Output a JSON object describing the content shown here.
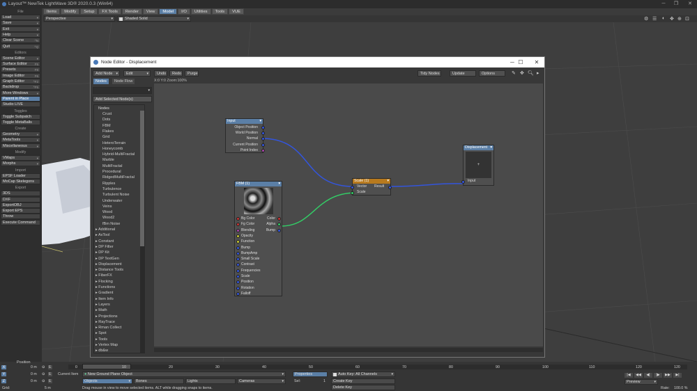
{
  "app": {
    "title": "Layout™ NewTek LightWave 3D® 2020.0.3 (Win64)"
  },
  "menubar": [
    "Items",
    "Modify",
    "Setup",
    "FX Tools",
    "Render",
    "View",
    "Model",
    "I/O",
    "Utilities",
    "Tools",
    "VUE"
  ],
  "viewbar": {
    "view_mode": "Perspective",
    "shading": "Shaded Solid"
  },
  "left_panel": [
    {
      "type": "head",
      "label": "File"
    },
    {
      "type": "item",
      "label": "Load",
      "sc": "▾"
    },
    {
      "type": "item",
      "label": "Save",
      "sc": "▾"
    },
    {
      "type": "item",
      "label": "Exit",
      "sc": "▾"
    },
    {
      "type": "item",
      "label": "Help",
      "sc": "▾"
    },
    {
      "type": "item",
      "label": "Clear Scene",
      "sc": "^N"
    },
    {
      "type": "item",
      "label": "Quit",
      "sc": "^Q"
    },
    {
      "type": "head",
      "label": "Editors"
    },
    {
      "type": "item",
      "label": "Scene Editor",
      "sc": "▾"
    },
    {
      "type": "item",
      "label": "Surface Editor",
      "sc": "F5"
    },
    {
      "type": "item",
      "label": "Presets",
      "sc": "F8"
    },
    {
      "type": "item",
      "label": "Image Editor",
      "sc": "F6"
    },
    {
      "type": "item",
      "label": "Graph Editor",
      "sc": "^F2"
    },
    {
      "type": "item",
      "label": "Backdrop",
      "sc": "^F5"
    },
    {
      "type": "item",
      "label": "More Windows",
      "sc": "▾"
    },
    {
      "type": "item",
      "label": "Parent in Place",
      "sc": "",
      "hl": true
    },
    {
      "type": "item",
      "label": "Studio LIVE",
      "sc": ""
    },
    {
      "type": "head",
      "label": "Toggles"
    },
    {
      "type": "item",
      "label": "Toggle Subpatch",
      "sc": ""
    },
    {
      "type": "item",
      "label": "Toggle MetaBalls",
      "sc": ""
    },
    {
      "type": "head",
      "label": "Create"
    },
    {
      "type": "item",
      "label": "Geometry",
      "sc": "▾"
    },
    {
      "type": "item",
      "label": "MetaTools",
      "sc": "▾"
    },
    {
      "type": "item",
      "label": "Miscellaneous",
      "sc": "▾"
    },
    {
      "type": "head",
      "label": "Modify"
    },
    {
      "type": "item",
      "label": "VMaps",
      "sc": "▾"
    },
    {
      "type": "item",
      "label": "Morphs",
      "sc": "▾"
    },
    {
      "type": "head",
      "label": "Import"
    },
    {
      "type": "item",
      "label": "EPSF Loader",
      "sc": ""
    },
    {
      "type": "item",
      "label": "MoCap Skelegons",
      "sc": ""
    },
    {
      "type": "head",
      "label": "Export"
    },
    {
      "type": "item",
      "label": "3DS",
      "sc": ""
    },
    {
      "type": "item",
      "label": "DXF",
      "sc": ""
    },
    {
      "type": "item",
      "label": "ExportOBJ",
      "sc": ""
    },
    {
      "type": "item",
      "label": "Export EPS",
      "sc": ""
    },
    {
      "type": "item",
      "label": "Throw",
      "sc": ""
    },
    {
      "type": "item",
      "label": "Execute Command",
      "sc": ""
    }
  ],
  "node_editor": {
    "title": "Node Editor - Displacement",
    "toolbar": {
      "add_node": "Add Node",
      "edit": "Edit",
      "undo": "Undo",
      "redo": "Redo",
      "purge": "Purge",
      "tidy": "Tidy Nodes",
      "update": "Update",
      "options": "Options"
    },
    "tabs": [
      "Nodes",
      "Node Flow"
    ],
    "add_selected": "Add Selected Node(s)",
    "status": "X:0 Y:0 Zoom:100%",
    "list_header": "Nodes",
    "list": [
      {
        "label": "Crust",
        "sub": true
      },
      {
        "label": "Dots",
        "sub": true
      },
      {
        "label": "FBM",
        "sub": true
      },
      {
        "label": "Flakes",
        "sub": true
      },
      {
        "label": "Grid",
        "sub": true
      },
      {
        "label": "HeteroTerrain",
        "sub": true
      },
      {
        "label": "Honeycomb",
        "sub": true
      },
      {
        "label": "Hybrid-MultiFractal",
        "sub": true
      },
      {
        "label": "Marble",
        "sub": true
      },
      {
        "label": "MultiFractal",
        "sub": true
      },
      {
        "label": "Procedural",
        "sub": true
      },
      {
        "label": "RidgedMultiFractal",
        "sub": true
      },
      {
        "label": "Ripples",
        "sub": true
      },
      {
        "label": "Turbulence",
        "sub": true
      },
      {
        "label": "Turbulent Noise",
        "sub": true
      },
      {
        "label": "Underwater",
        "sub": true
      },
      {
        "label": "Veins",
        "sub": true
      },
      {
        "label": "Wood",
        "sub": true
      },
      {
        "label": "Wood2",
        "sub": true
      },
      {
        "label": "fBm Noise",
        "sub": true
      },
      {
        "label": "Additional",
        "sub": false
      },
      {
        "label": "AxTool",
        "sub": false
      },
      {
        "label": "Constant",
        "sub": false
      },
      {
        "label": "DP Filter",
        "sub": false
      },
      {
        "label": "DP Kit",
        "sub": false
      },
      {
        "label": "DP TextGen",
        "sub": false
      },
      {
        "label": "Displacement",
        "sub": false
      },
      {
        "label": "Distance Tools",
        "sub": false
      },
      {
        "label": "FiberFX",
        "sub": false
      },
      {
        "label": "Flocking",
        "sub": false
      },
      {
        "label": "Functions",
        "sub": false
      },
      {
        "label": "Gradient",
        "sub": false
      },
      {
        "label": "Item Info",
        "sub": false
      },
      {
        "label": "Layers",
        "sub": false
      },
      {
        "label": "Math",
        "sub": false
      },
      {
        "label": "Projections",
        "sub": false
      },
      {
        "label": "RayTrace",
        "sub": false
      },
      {
        "label": "Rman Collect",
        "sub": false
      },
      {
        "label": "Spot",
        "sub": false
      },
      {
        "label": "Tools",
        "sub": false
      },
      {
        "label": "Vertex Map",
        "sub": false
      },
      {
        "label": "db&w",
        "sub": false
      }
    ],
    "nodes": {
      "input": {
        "title": "Input",
        "outputs": [
          "Object Position",
          "World Position",
          "Normal",
          "Current Position",
          "Point Index"
        ]
      },
      "fbm": {
        "title": "FBM (1)",
        "inputs": [
          "Bg Color",
          "Fg Color",
          "Blending",
          "Opacity",
          "Function",
          "Bump",
          "BumpAmp",
          "Small Scale",
          "Contrast",
          "Frequencies",
          "Scale",
          "Position",
          "Rotation",
          "Falloff"
        ],
        "outputs": [
          "Color",
          "Alpha",
          "Bump"
        ]
      },
      "scale": {
        "title": "Scale (1)",
        "inputs": [
          "Vector",
          "Scale"
        ],
        "output": "Result"
      },
      "displacement": {
        "title": "Displacement",
        "input": "Input",
        "preview": "+"
      }
    }
  },
  "timeline": {
    "position_label": "Position",
    "ticks": [
      "0",
      "10",
      "20",
      "30",
      "40",
      "50",
      "60",
      "70",
      "80",
      "90",
      "100",
      "110",
      "120"
    ],
    "end_frame": "120",
    "axes": [
      {
        "axis": "X",
        "value": "0 m"
      },
      {
        "axis": "Y",
        "value": "0 m"
      },
      {
        "axis": "Z",
        "value": "0 m"
      }
    ],
    "grid_label": "Grid:",
    "grid_value": "5 m",
    "current_item_label": "Current Item",
    "current_item": "New Ground Plane Object",
    "objects": "Objects",
    "bones": "Bones",
    "lights": "Lights",
    "cameras": "Cameras",
    "properties": "Properties",
    "sel_label": "Sel:",
    "sel_value": "1",
    "autokey": "Auto Key: All Channels",
    "create_key": "Create Key",
    "delete_key": "Delete Key",
    "preview": "Preview",
    "rate_label": "Rate:",
    "rate_value": "100.0 %",
    "status": "Drag mouse in view to move selected items. ALT while dragging snaps to items."
  },
  "colors": {
    "accent": "#5b7fa6",
    "fbm_header": "#5b7fa6",
    "scale_header": "#b87a1e",
    "wire_blue": "#3355dd",
    "wire_green": "#33cc66"
  }
}
